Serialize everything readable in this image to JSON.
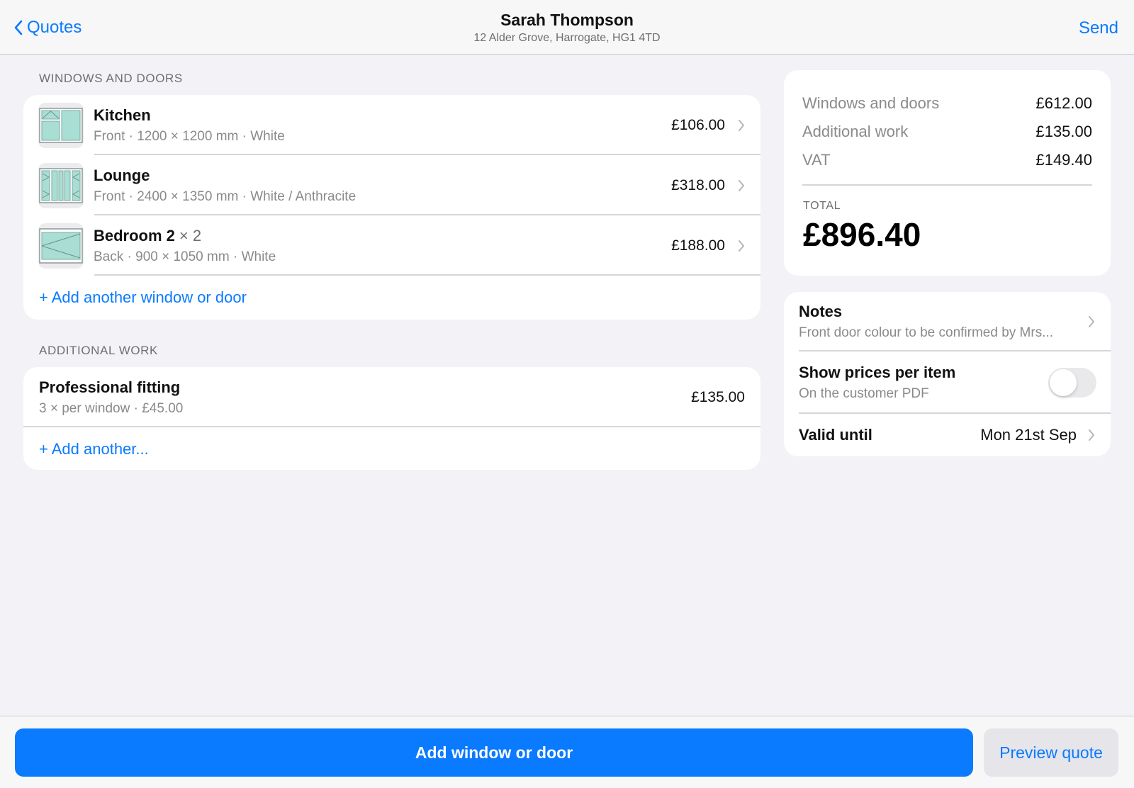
{
  "nav": {
    "back_label": "Quotes",
    "title": "Sarah Thompson",
    "subtitle": "12 Alder Grove, Harrogate, HG1 4TD",
    "send_label": "Send"
  },
  "windows_section": {
    "header": "WINDOWS AND DOORS",
    "items": [
      {
        "name": "Kitchen",
        "qty": "",
        "details": "Front · 1200 × 1200 mm · White",
        "price": "£106.00",
        "icon": "kitchen-window-icon"
      },
      {
        "name": "Lounge",
        "qty": "",
        "details": "Front · 2400 × 1350 mm · White / Anthracite",
        "price": "£318.00",
        "icon": "lounge-window-icon"
      },
      {
        "name": "Bedroom 2",
        "qty": "× 2",
        "details": "Back · 900 × 1050 mm · White",
        "price": "£188.00",
        "icon": "bedroom-window-icon"
      }
    ],
    "add_label": "+ Add another window or door"
  },
  "additional_section": {
    "header": "ADDITIONAL WORK",
    "items": [
      {
        "name": "Professional fitting",
        "details": "3 × per window · £45.00",
        "price": "£135.00"
      }
    ],
    "add_label": "+ Add another..."
  },
  "summary": {
    "lines": [
      {
        "label": "Windows and doors",
        "value": "£612.00"
      },
      {
        "label": "Additional work",
        "value": "£135.00"
      },
      {
        "label": "VAT",
        "value": "£149.40"
      }
    ],
    "total_label": "TOTAL",
    "total_value": "£896.40"
  },
  "settings": {
    "notes_title": "Notes",
    "notes_preview": "Front door colour to be confirmed by Mrs...",
    "show_prices_title": "Show prices per item",
    "show_prices_sub": "On the customer PDF",
    "show_prices_enabled": false,
    "valid_until_label": "Valid until",
    "valid_until_value": "Mon 21st Sep"
  },
  "bottom": {
    "primary_label": "Add window or door",
    "secondary_label": "Preview quote"
  },
  "colors": {
    "accent": "#0a7aff",
    "background": "#f2f2f7",
    "glass": "#a8ded3"
  }
}
